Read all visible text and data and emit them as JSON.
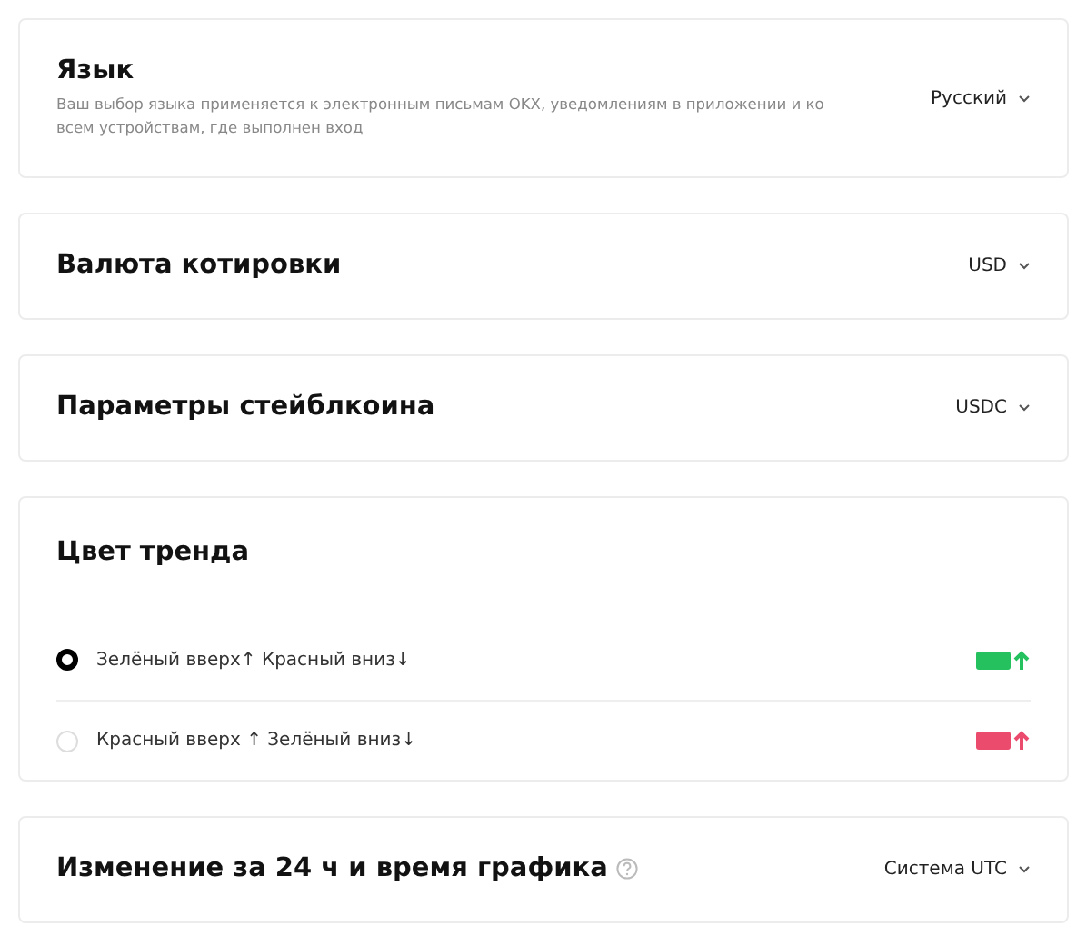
{
  "settings": [
    {
      "kind": "select",
      "title": "Язык",
      "description": "Ваш выбор языка применяется к электронным письмам OKX, уведомлениям в приложении и ко всем устройствам, где выполнен вход",
      "value": "Русский"
    },
    {
      "kind": "select",
      "title": "Валюта котировки",
      "value": "USD"
    },
    {
      "kind": "select",
      "title": "Параметры стейблкоина",
      "value": "USDC"
    },
    {
      "kind": "radio",
      "title": "Цвет тренда",
      "options": [
        {
          "label": "Зелёный вверх↑ Красный вниз↓",
          "selected": true,
          "color": "#25c15f"
        },
        {
          "label": "Красный вверх ↑ Зелёный вниз↓",
          "selected": false,
          "color": "#eb4b6d"
        }
      ]
    },
    {
      "kind": "select",
      "title": "Изменение за 24 ч и время графика",
      "help": true,
      "value": "Система UTC"
    }
  ]
}
